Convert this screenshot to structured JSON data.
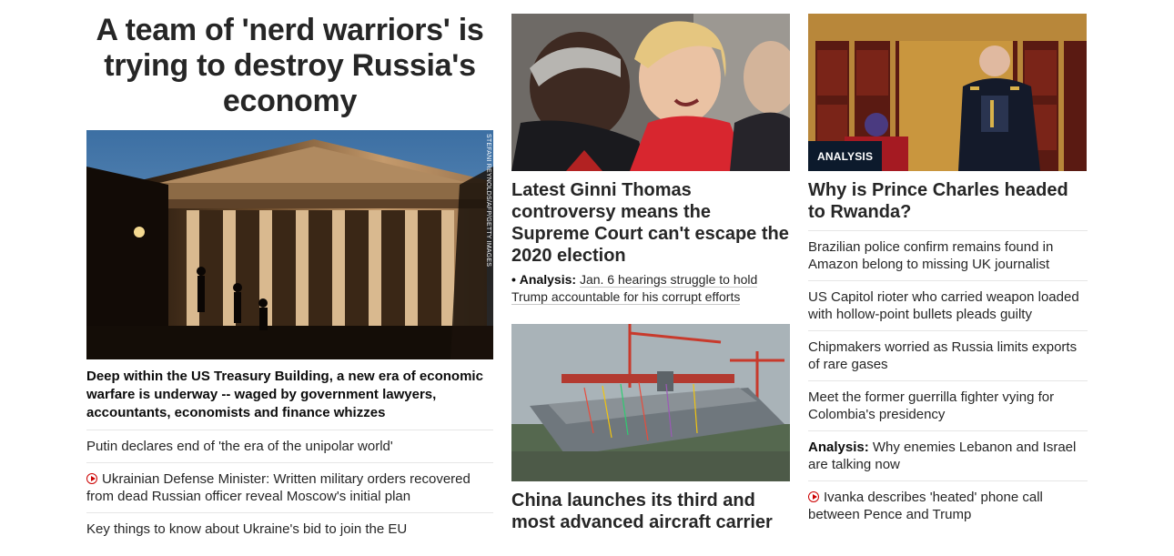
{
  "lead": {
    "headline": "A team of 'nerd warriors' is trying to destroy Russia's economy",
    "image_credit": "STEFANI REYNOLDS/AFP/GETTY IMAGES",
    "caption": "Deep within the US Treasury Building, a new era of economic warfare is underway -- waged by government lawyers, accountants, economists and finance whizzes",
    "related": [
      {
        "text": "Putin declares end of 'the era of the unipolar world'",
        "video": false
      },
      {
        "text": "Ukrainian Defense Minister: Written military orders recovered from dead Russian officer reveal Moscow's initial plan",
        "video": true
      },
      {
        "text": "Key things to know about Ukraine's bid to join the EU",
        "video": false
      }
    ]
  },
  "middle": {
    "card1": {
      "headline": "Latest Ginni Thomas controversy means the Supreme Court can't escape the 2020 election",
      "bullet": "•",
      "sub_label": "Analysis:",
      "sub_text": "Jan. 6 hearings struggle to hold Trump accountable for his corrupt efforts"
    },
    "card2": {
      "headline": "China launches its third and most advanced aircraft carrier"
    }
  },
  "right": {
    "badge": "ANALYSIS",
    "headline": "Why is Prince Charles headed to Rwanda?",
    "items": [
      {
        "label": "",
        "text": "Brazilian police confirm remains found in Amazon belong to missing UK journalist",
        "video": false
      },
      {
        "label": "",
        "text": "US Capitol rioter who carried weapon loaded with hollow-point bullets pleads guilty",
        "video": false
      },
      {
        "label": "",
        "text": "Chipmakers worried as Russia limits exports of rare gases",
        "video": false
      },
      {
        "label": "",
        "text": "Meet the former guerrilla fighter vying for Colombia's presidency",
        "video": false
      },
      {
        "label": "Analysis:",
        "text": "Why enemies Lebanon and Israel are talking now",
        "video": false
      },
      {
        "label": "",
        "text": "Ivanka describes 'heated' phone call between Pence and Trump",
        "video": true
      }
    ]
  },
  "colors": {
    "text": "#262626",
    "video_icon": "#cc0000",
    "badge_bg": "#0c1a2c",
    "divider": "#e6e6e6"
  }
}
